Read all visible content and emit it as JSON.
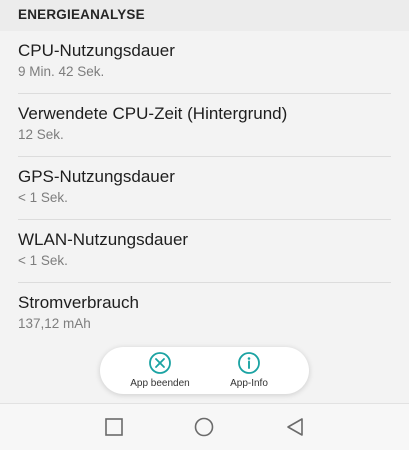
{
  "section": {
    "title": "ENERGIEANALYSE"
  },
  "items": [
    {
      "label": "CPU-Nutzungsdauer",
      "value": "9 Min. 42 Sek."
    },
    {
      "label": "Verwendete CPU-Zeit (Hintergrund)",
      "value": "12 Sek."
    },
    {
      "label": "GPS-Nutzungsdauer",
      "value": "< 1 Sek."
    },
    {
      "label": "WLAN-Nutzungsdauer",
      "value": "< 1 Sek."
    },
    {
      "label": "Stromverbrauch",
      "value": "137,12 mAh"
    }
  ],
  "actions": {
    "end_app": {
      "label": "App beenden",
      "icon": "close-circle-icon"
    },
    "app_info": {
      "label": "App-Info",
      "icon": "info-circle-icon"
    }
  },
  "navbar": {
    "recents_icon": "square-icon",
    "home_icon": "circle-icon",
    "back_icon": "triangle-back-icon"
  },
  "colors": {
    "accent": "#1ba3a3",
    "background": "#f3f3f3",
    "header_background": "#ececec"
  }
}
